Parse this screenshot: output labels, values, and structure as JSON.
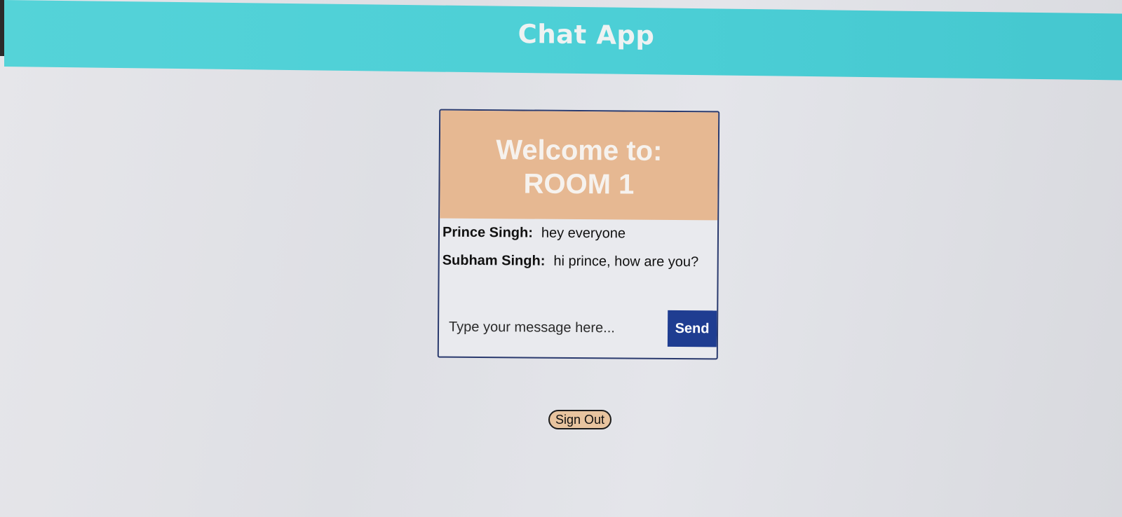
{
  "app": {
    "title": "Chat App"
  },
  "room": {
    "welcome_text": "Welcome to:",
    "name": "ROOM 1"
  },
  "messages": [
    {
      "author": "Prince Singh:",
      "text": "hey everyone"
    },
    {
      "author": "Subham Singh:",
      "text": "hi prince, how are you?"
    }
  ],
  "composer": {
    "placeholder": "Type your message here...",
    "value": "",
    "send_label": "Send"
  },
  "sign_out_label": "Sign Out",
  "colors": {
    "header": "#4ccfd6",
    "room_banner": "#e6b892",
    "send_button": "#1f3d91",
    "sign_out_button": "#e8c49f"
  }
}
